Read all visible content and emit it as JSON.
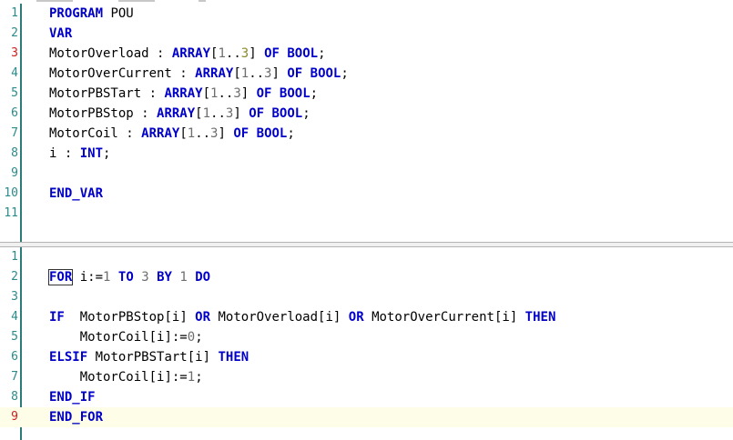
{
  "colors": {
    "keyword": "#0000c8",
    "identifier": "#000000",
    "number": "#6e6e6e",
    "line_number": "#2b8a8a",
    "line_number_marked": "#d21e1e",
    "current_line_bg": "#fdfde8",
    "gutter_border": "#2b7b7b"
  },
  "declaration": {
    "lines": [
      {
        "n": "1",
        "tokens": [
          {
            "t": "kw",
            "v": "PROGRAM"
          },
          {
            "t": "id",
            "v": " POU"
          }
        ]
      },
      {
        "n": "2",
        "tokens": [
          {
            "t": "kw",
            "v": "VAR"
          }
        ]
      },
      {
        "n": "3",
        "marked": true,
        "tokens": [
          {
            "t": "id",
            "v": "MotorOverload "
          },
          {
            "t": "op",
            "v": ": "
          },
          {
            "t": "kw",
            "v": "ARRAY"
          },
          {
            "t": "op",
            "v": "["
          },
          {
            "t": "num",
            "v": "1"
          },
          {
            "t": "op",
            "v": ".."
          },
          {
            "t": "numhl",
            "v": "3"
          },
          {
            "t": "op",
            "v": "] "
          },
          {
            "t": "kw",
            "v": "OF"
          },
          {
            "t": "op",
            "v": " "
          },
          {
            "t": "kw",
            "v": "BOOL"
          },
          {
            "t": "op",
            "v": ";"
          }
        ]
      },
      {
        "n": "4",
        "tokens": [
          {
            "t": "id",
            "v": "MotorOverCurrent "
          },
          {
            "t": "op",
            "v": ": "
          },
          {
            "t": "kw",
            "v": "ARRAY"
          },
          {
            "t": "op",
            "v": "["
          },
          {
            "t": "num",
            "v": "1"
          },
          {
            "t": "op",
            "v": ".."
          },
          {
            "t": "num",
            "v": "3"
          },
          {
            "t": "op",
            "v": "] "
          },
          {
            "t": "kw",
            "v": "OF"
          },
          {
            "t": "op",
            "v": " "
          },
          {
            "t": "kw",
            "v": "BOOL"
          },
          {
            "t": "op",
            "v": ";"
          }
        ]
      },
      {
        "n": "5",
        "tokens": [
          {
            "t": "id",
            "v": "MotorPBSTart "
          },
          {
            "t": "op",
            "v": ": "
          },
          {
            "t": "kw",
            "v": "ARRAY"
          },
          {
            "t": "op",
            "v": "["
          },
          {
            "t": "num",
            "v": "1"
          },
          {
            "t": "op",
            "v": ".."
          },
          {
            "t": "num",
            "v": "3"
          },
          {
            "t": "op",
            "v": "] "
          },
          {
            "t": "kw",
            "v": "OF"
          },
          {
            "t": "op",
            "v": " "
          },
          {
            "t": "kw",
            "v": "BOOL"
          },
          {
            "t": "op",
            "v": ";"
          }
        ]
      },
      {
        "n": "6",
        "tokens": [
          {
            "t": "id",
            "v": "MotorPBStop "
          },
          {
            "t": "op",
            "v": ": "
          },
          {
            "t": "kw",
            "v": "ARRAY"
          },
          {
            "t": "op",
            "v": "["
          },
          {
            "t": "num",
            "v": "1"
          },
          {
            "t": "op",
            "v": ".."
          },
          {
            "t": "num",
            "v": "3"
          },
          {
            "t": "op",
            "v": "] "
          },
          {
            "t": "kw",
            "v": "OF"
          },
          {
            "t": "op",
            "v": " "
          },
          {
            "t": "kw",
            "v": "BOOL"
          },
          {
            "t": "op",
            "v": ";"
          }
        ]
      },
      {
        "n": "7",
        "tokens": [
          {
            "t": "id",
            "v": "MotorCoil "
          },
          {
            "t": "op",
            "v": ": "
          },
          {
            "t": "kw",
            "v": "ARRAY"
          },
          {
            "t": "op",
            "v": "["
          },
          {
            "t": "num",
            "v": "1"
          },
          {
            "t": "op",
            "v": ".."
          },
          {
            "t": "num",
            "v": "3"
          },
          {
            "t": "op",
            "v": "] "
          },
          {
            "t": "kw",
            "v": "OF"
          },
          {
            "t": "op",
            "v": " "
          },
          {
            "t": "kw",
            "v": "BOOL"
          },
          {
            "t": "op",
            "v": ";"
          }
        ]
      },
      {
        "n": "8",
        "tokens": [
          {
            "t": "id",
            "v": "i "
          },
          {
            "t": "op",
            "v": ": "
          },
          {
            "t": "kw",
            "v": "INT"
          },
          {
            "t": "op",
            "v": ";"
          }
        ]
      },
      {
        "n": "9",
        "tokens": []
      },
      {
        "n": "10",
        "tokens": [
          {
            "t": "kw",
            "v": "END_VAR"
          }
        ]
      },
      {
        "n": "11",
        "tokens": []
      }
    ]
  },
  "implementation": {
    "lines": [
      {
        "n": "1",
        "tokens": []
      },
      {
        "n": "2",
        "tokens": [
          {
            "t": "kwbox",
            "v": "FOR"
          },
          {
            "t": "id",
            "v": " i"
          },
          {
            "t": "op",
            "v": ":="
          },
          {
            "t": "num",
            "v": "1"
          },
          {
            "t": "op",
            "v": " "
          },
          {
            "t": "kw",
            "v": "TO"
          },
          {
            "t": "op",
            "v": " "
          },
          {
            "t": "num",
            "v": "3"
          },
          {
            "t": "op",
            "v": " "
          },
          {
            "t": "kw",
            "v": "BY"
          },
          {
            "t": "op",
            "v": " "
          },
          {
            "t": "num",
            "v": "1"
          },
          {
            "t": "op",
            "v": " "
          },
          {
            "t": "kw",
            "v": "DO"
          }
        ]
      },
      {
        "n": "3",
        "tokens": []
      },
      {
        "n": "4",
        "tokens": [
          {
            "t": "kw",
            "v": "IF"
          },
          {
            "t": "id",
            "v": "  MotorPBStop"
          },
          {
            "t": "op",
            "v": "["
          },
          {
            "t": "id",
            "v": "i"
          },
          {
            "t": "op",
            "v": "] "
          },
          {
            "t": "kw",
            "v": "OR"
          },
          {
            "t": "id",
            "v": " MotorOverload"
          },
          {
            "t": "op",
            "v": "["
          },
          {
            "t": "id",
            "v": "i"
          },
          {
            "t": "op",
            "v": "] "
          },
          {
            "t": "kw",
            "v": "OR"
          },
          {
            "t": "id",
            "v": " MotorOverCurrent"
          },
          {
            "t": "op",
            "v": "["
          },
          {
            "t": "id",
            "v": "i"
          },
          {
            "t": "op",
            "v": "] "
          },
          {
            "t": "kw",
            "v": "THEN"
          }
        ]
      },
      {
        "n": "5",
        "tokens": [
          {
            "t": "id",
            "v": "    MotorCoil"
          },
          {
            "t": "op",
            "v": "["
          },
          {
            "t": "id",
            "v": "i"
          },
          {
            "t": "op",
            "v": "]:="
          },
          {
            "t": "num",
            "v": "0"
          },
          {
            "t": "op",
            "v": ";"
          }
        ]
      },
      {
        "n": "6",
        "tokens": [
          {
            "t": "kw",
            "v": "ELSIF"
          },
          {
            "t": "id",
            "v": " MotorPBSTart"
          },
          {
            "t": "op",
            "v": "["
          },
          {
            "t": "id",
            "v": "i"
          },
          {
            "t": "op",
            "v": "] "
          },
          {
            "t": "kw",
            "v": "THEN"
          }
        ]
      },
      {
        "n": "7",
        "tokens": [
          {
            "t": "id",
            "v": "    MotorCoil"
          },
          {
            "t": "op",
            "v": "["
          },
          {
            "t": "id",
            "v": "i"
          },
          {
            "t": "op",
            "v": "]:="
          },
          {
            "t": "num",
            "v": "1"
          },
          {
            "t": "op",
            "v": ";"
          }
        ]
      },
      {
        "n": "8",
        "tokens": [
          {
            "t": "kw",
            "v": "END_IF"
          }
        ]
      },
      {
        "n": "9",
        "marked": true,
        "current": true,
        "tokens": [
          {
            "t": "kw",
            "v": "END_FOR"
          }
        ]
      }
    ]
  }
}
